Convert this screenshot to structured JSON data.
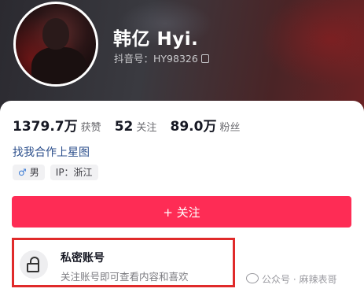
{
  "profile": {
    "name": "韩亿 Hyi.",
    "id_line": "抖音号：HY98326"
  },
  "stats": [
    {
      "value": "1379.7万",
      "label": "获赞"
    },
    {
      "value": "52",
      "label": "关注"
    },
    {
      "value": "89.0万",
      "label": "粉丝"
    }
  ],
  "cta_link": "找我合作上星图",
  "tags": [
    {
      "icon": "male-icon",
      "text": "男"
    },
    {
      "text": "IP：浙江"
    }
  ],
  "follow_button": {
    "label": "+ 关注"
  },
  "private_account": {
    "title": "私密账号",
    "description": "关注账号即可查看内容和喜欢"
  },
  "watermark": "公众号 · 麻辣表哥",
  "colors": {
    "accent": "#fe2c55",
    "highlight_box": "#e02a2a",
    "link": "#2c4f8c"
  }
}
